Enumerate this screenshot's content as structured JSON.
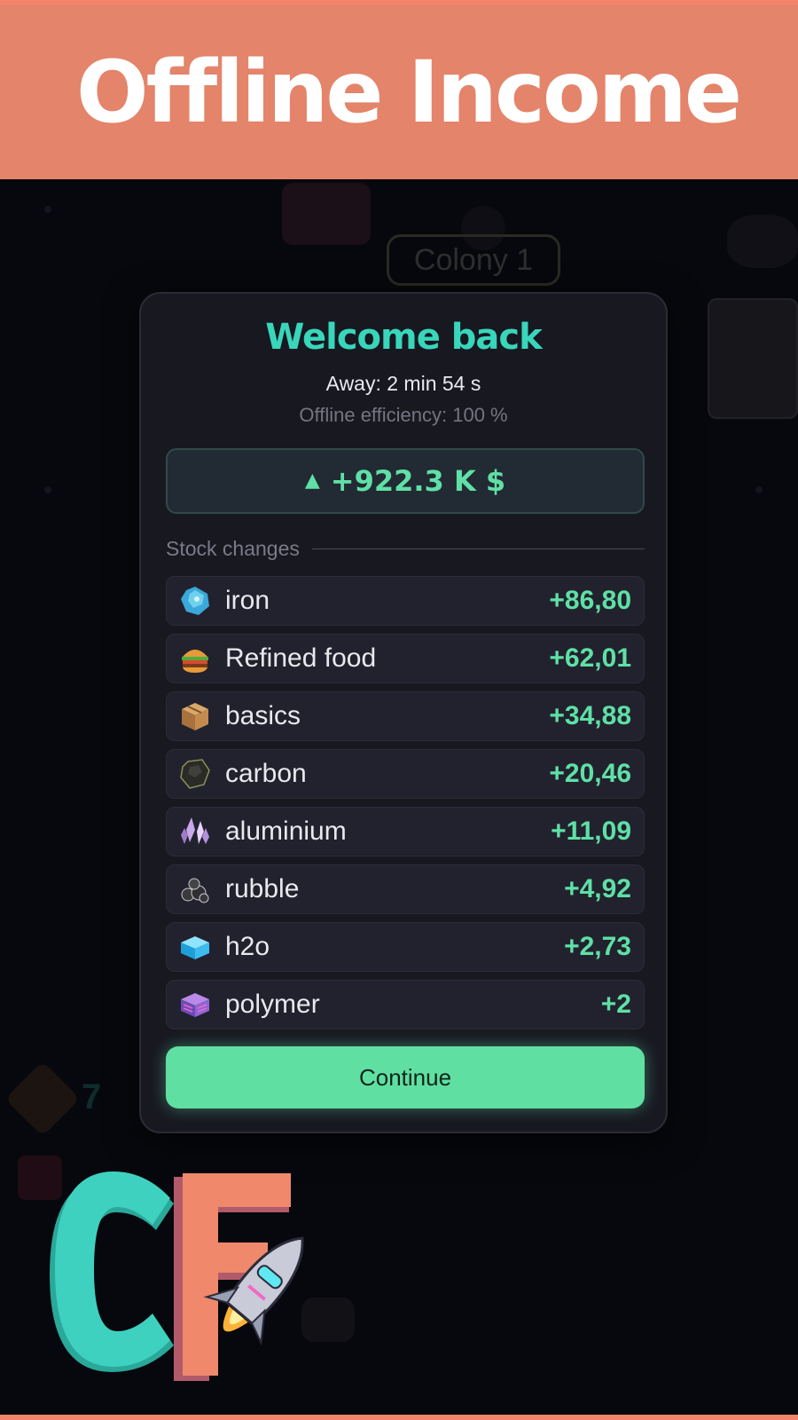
{
  "banner": {
    "title": "Offline Income"
  },
  "background": {
    "colony_label": "Colony 1",
    "stat_values": [
      "7"
    ]
  },
  "dialog": {
    "title": "Welcome back",
    "away": "Away: 2 min 54 s",
    "efficiency": "Offline efficiency: 100 %",
    "income_arrow": "▲",
    "income": "+922.3 K $",
    "stock_label": "Stock changes",
    "continue_label": "Continue"
  },
  "stock_changes": [
    {
      "icon": "iron-ore-icon",
      "name": "iron",
      "value": "+86,80"
    },
    {
      "icon": "burger-icon",
      "name": "Refined food",
      "value": "+62,01"
    },
    {
      "icon": "crate-icon",
      "name": "basics",
      "value": "+34,88"
    },
    {
      "icon": "coal-icon",
      "name": "carbon",
      "value": "+20,46"
    },
    {
      "icon": "crystal-icon",
      "name": "aluminium",
      "value": "+11,09"
    },
    {
      "icon": "rubble-icon",
      "name": "rubble",
      "value": "+4,92"
    },
    {
      "icon": "water-cube-icon",
      "name": "h2o",
      "value": "+2,73"
    },
    {
      "icon": "polymer-icon",
      "name": "polymer",
      "value": "+2"
    }
  ],
  "colors": {
    "banner": "#e4846a",
    "accent_teal": "#38d6bb",
    "accent_green": "#5fe0a6",
    "button": "#5fe0a2",
    "panel": "#181821"
  }
}
